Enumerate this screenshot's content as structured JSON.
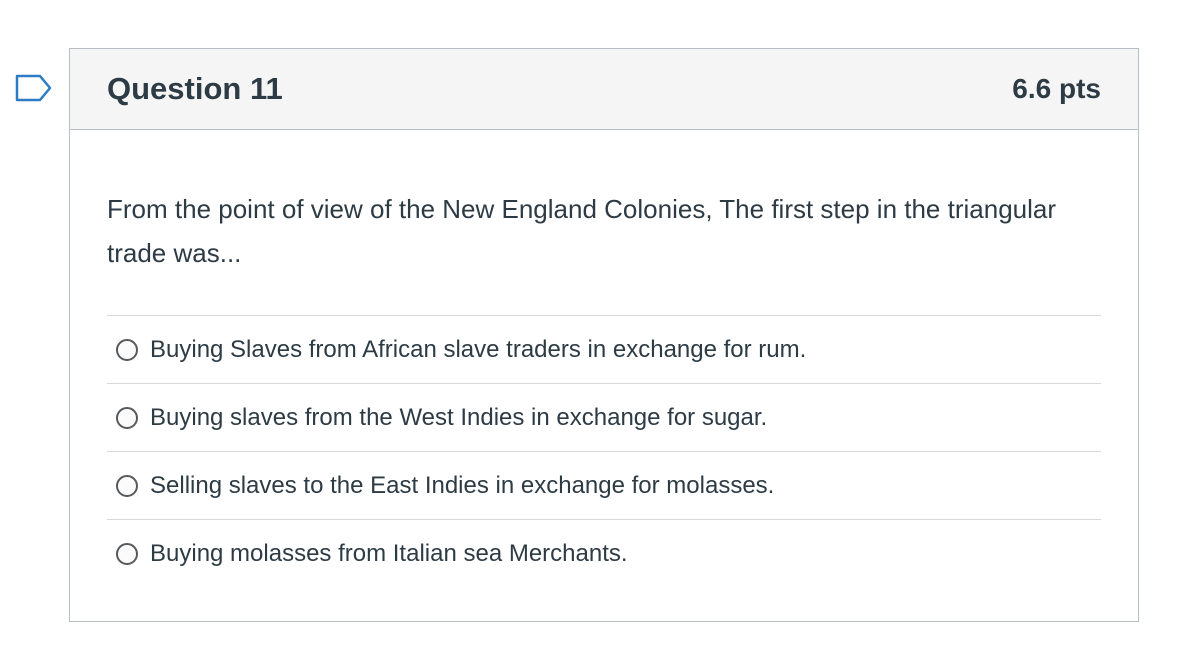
{
  "question": {
    "title": "Question 11",
    "points": "6.6 pts",
    "text": "From the point of view of the New England Colonies, The first step in the triangular trade was...",
    "answers": [
      {
        "label": "Buying Slaves from African slave traders in exchange for rum."
      },
      {
        "label": "Buying slaves from the West Indies in exchange for sugar."
      },
      {
        "label": "Selling slaves to the East Indies in exchange for molasses."
      },
      {
        "label": "Buying molasses from Italian sea Merchants."
      }
    ]
  },
  "icons": {
    "flag": "flag-question-icon"
  },
  "colors": {
    "flag": "#2d7bc4",
    "text": "#2d3b45",
    "header_bg": "#f5f5f5",
    "border": "#b9bec4"
  }
}
